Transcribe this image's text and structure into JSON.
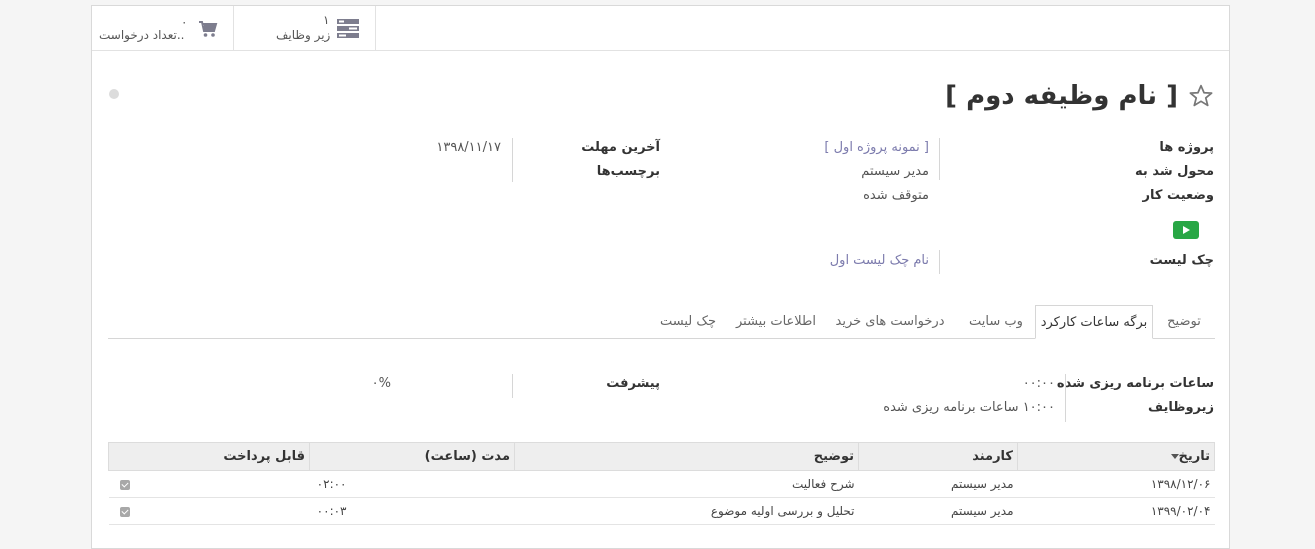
{
  "button_box": {
    "subtasks": {
      "count": "۱",
      "label": "زیر وظایف"
    },
    "requests": {
      "count": "۰",
      "label": "تعداد درخواست.."
    }
  },
  "title": {
    "text": "[ نام وظیفه دوم ]"
  },
  "fields": {
    "project": {
      "label": "پروژه ها",
      "value": "[ نمونه پروژه اول ]"
    },
    "assigned": {
      "label": "محول شد به",
      "value": "مدیر سیستم"
    },
    "stage": {
      "label": "وضعیت کار",
      "value": "متوقف شده"
    },
    "deadline": {
      "label": "آخرین مهلت",
      "value": "۱۳۹۸/۱۱/۱۷"
    },
    "tags": {
      "label": "برچسب‌ها",
      "value": ""
    },
    "checklist": {
      "label": "چک لیست",
      "value": "نام چک لیست اول"
    }
  },
  "tabs": [
    {
      "label": "توضیح",
      "active": false
    },
    {
      "label": "برگه ساعات کارکرد",
      "active": true
    },
    {
      "label": "وب سایت",
      "active": false
    },
    {
      "label": "درخواست های خرید",
      "active": false
    },
    {
      "label": "اطلاعات بیشتر",
      "active": false
    },
    {
      "label": "چک لیست",
      "active": false
    }
  ],
  "timesheet": {
    "planned_label": "ساعات برنامه ریزی شده",
    "planned_value": "۰۰:۰۰",
    "subtasks_label": "زیروظایف",
    "subtasks_value": "۱۰:۰۰ ساعات برنامه ریزی شده",
    "progress_label": "پیشرفت",
    "progress_value": "۰%"
  },
  "table": {
    "columns": [
      "تاریخ",
      "کارمند",
      "توضیح",
      "مدت (ساعت)",
      "قابل پرداخت"
    ],
    "rows": [
      {
        "date": "۱۳۹۸/۱۲/۰۶",
        "employee": "مدیر سیستم",
        "desc": "شرح فعالیت",
        "duration": "۰۲:۰۰",
        "billable": true
      },
      {
        "date": "۱۳۹۹/۰۲/۰۴",
        "employee": "مدیر سیستم",
        "desc": "تحلیل و بررسی اولیه موضوع",
        "duration": "۰۰:۰۳",
        "billable": true
      }
    ]
  },
  "colors": {
    "accent": "#7c7bad",
    "play_button": "#28a745"
  }
}
